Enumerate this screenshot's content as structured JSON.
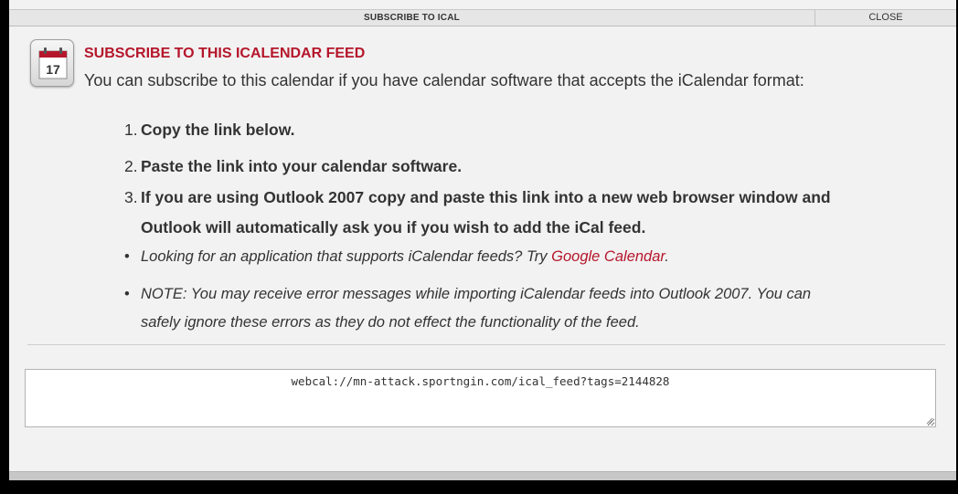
{
  "dialog": {
    "title": "SUBSCRIBE TO ICAL",
    "close_label": "CLOSE"
  },
  "icon": {
    "name": "calendar-icon",
    "day": "17",
    "accent": "#b5162b"
  },
  "content": {
    "heading": "SUBSCRIBE TO THIS ICALENDAR FEED",
    "intro": "You can subscribe to this calendar if you have calendar software that accepts the iCalendar format:",
    "steps": [
      {
        "num": "1.",
        "text": "Copy the link below."
      },
      {
        "num": "2.",
        "text": "Paste the link into your calendar software."
      },
      {
        "num": "3.",
        "text": "If you are using Outlook 2007 copy and paste this link into a new web browser window and",
        "cont": "Outlook will automatically ask you if you wish to add the iCal feed."
      }
    ],
    "bullets": [
      {
        "text": "Looking for an application that supports iCalendar feeds? Try ",
        "link": "Google Calendar",
        "after": "."
      },
      {
        "text": "NOTE: You may receive error messages while importing iCalendar feeds into Outlook 2007. You can",
        "cont": "safely ignore these errors as they do not effect the functionality of the feed."
      }
    ]
  },
  "feed": {
    "url": "webcal://mn-attack.sportngin.com/ical_feed?tags=2144828"
  },
  "colors": {
    "accent": "#b5162b",
    "text": "#333333",
    "background": "#f2f2f2"
  }
}
